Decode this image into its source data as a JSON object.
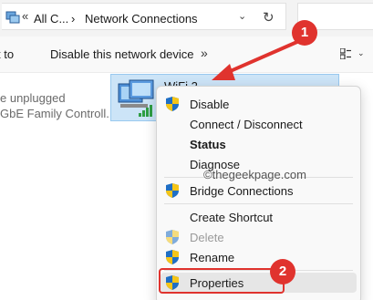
{
  "address_bar": {
    "chevrons": "«",
    "crumb_1": "All C...",
    "separator": "›",
    "crumb_2": "Network Connections",
    "dropdown_icon": "chevron-down-icon",
    "refresh_icon": "refresh-icon"
  },
  "toolbar": {
    "organize_partial": "t to",
    "disable_label": "Disable this network device",
    "more_label": "»",
    "view_icon": "view-options-icon"
  },
  "left_adapter": {
    "status": "e unplugged",
    "device": "GbE Family Controll..."
  },
  "wifi_adapter": {
    "name": "WiFi 2",
    "icon": "network-adapter-icon"
  },
  "context_menu": {
    "items": [
      {
        "label": "Disable",
        "shield": true
      },
      {
        "label": "Connect / Disconnect",
        "shield": false
      },
      {
        "label": "Status",
        "shield": false
      },
      {
        "label": "Diagnose",
        "shield": false
      },
      {
        "label": "Bridge Connections",
        "shield": true
      },
      {
        "label": "Create Shortcut",
        "shield": false
      },
      {
        "label": "Delete",
        "shield": true
      },
      {
        "label": "Rename",
        "shield": true
      },
      {
        "label": "Properties",
        "shield": true
      }
    ]
  },
  "watermark": "©thegeekpage.com",
  "annotations": {
    "step_1": "1",
    "step_2": "2",
    "color": "#e0332e"
  },
  "colors": {
    "selection_bg": "#cce4f7",
    "shield_blue": "#1f6fc5",
    "shield_yellow": "#f5c518"
  }
}
